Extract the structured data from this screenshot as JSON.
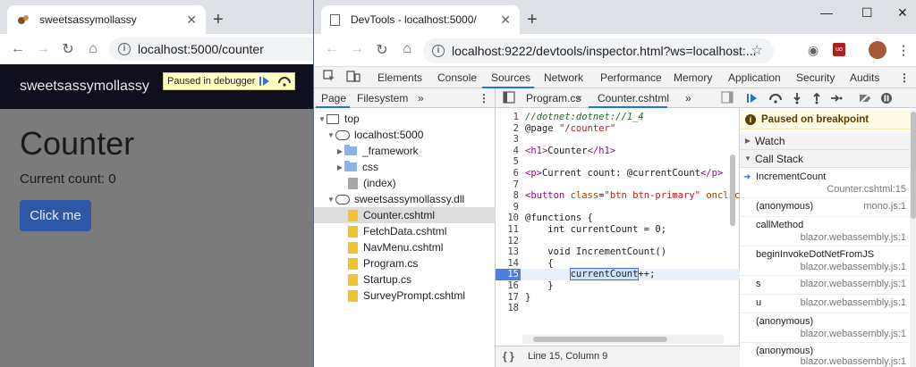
{
  "app_window": {
    "tab_title": "sweetsassymollassy",
    "url": "localhost:5000/counter",
    "paused_banner": "Paused in debugger",
    "site_brand": "sweetsassymollassy",
    "page_heading": "Counter",
    "current_count_text": "Current count: 0",
    "click_button": "Click me"
  },
  "devtools_window": {
    "tab_title": "DevTools - localhost:5000/",
    "url": "localhost:9222/devtools/inspector.html?ws=localhost:...",
    "panel_tabs": [
      "Elements",
      "Console",
      "Sources",
      "Network",
      "Performance",
      "Memory",
      "Application",
      "Security",
      "Audits"
    ],
    "active_panel": "Sources",
    "navigator": {
      "tabs": [
        "Page",
        "Filesystem"
      ],
      "tree": [
        {
          "label": "top"
        },
        {
          "label": "localhost:5000"
        },
        {
          "label": "_framework"
        },
        {
          "label": "css"
        },
        {
          "label": "(index)"
        },
        {
          "label": "sweetsassymollassy.dll"
        },
        {
          "label": "Counter.cshtml"
        },
        {
          "label": "FetchData.cshtml"
        },
        {
          "label": "NavMenu.cshtml"
        },
        {
          "label": "Program.cs"
        },
        {
          "label": "Startup.cs"
        },
        {
          "label": "SurveyPrompt.cshtml"
        }
      ]
    },
    "editor": {
      "tabs": [
        "Program.cs",
        "Counter.cshtml"
      ],
      "active_tab": "Counter.cshtml",
      "line_numbers": [
        "1",
        "2",
        "3",
        "4",
        "5",
        "6",
        "7",
        "8",
        "9",
        "10",
        "11",
        "12",
        "13",
        "14",
        "15",
        "16",
        "17",
        "18"
      ],
      "status": "Line 15, Column 9"
    },
    "debugger": {
      "paused_message": "Paused on breakpoint",
      "watch_label": "Watch",
      "call_stack_label": "Call Stack",
      "call_stack": [
        {
          "fn": "IncrementCount",
          "loc": "Counter.cshtml:15"
        },
        {
          "fn": "(anonymous)",
          "loc": "mono.js:1"
        },
        {
          "fn": "callMethod",
          "loc": "blazor.webassembly.js:1"
        },
        {
          "fn": "beginInvokeDotNetFromJS",
          "loc": "blazor.webassembly.js:1"
        },
        {
          "fn": "s",
          "loc": "blazor.webassembly.js:1"
        },
        {
          "fn": "u",
          "loc": "blazor.webassembly.js:1"
        },
        {
          "fn": "(anonymous)",
          "loc": "blazor.webassembly.js:1"
        },
        {
          "fn": "(anonymous)",
          "loc": "blazor.webassembly.js:1"
        }
      ]
    }
  },
  "colors": {
    "brand_nav": "#0f0f1e",
    "primary_button": "#2d58a8",
    "active_tab_underline": "#1a73e8",
    "breakpoint": "#4d7ee0"
  }
}
